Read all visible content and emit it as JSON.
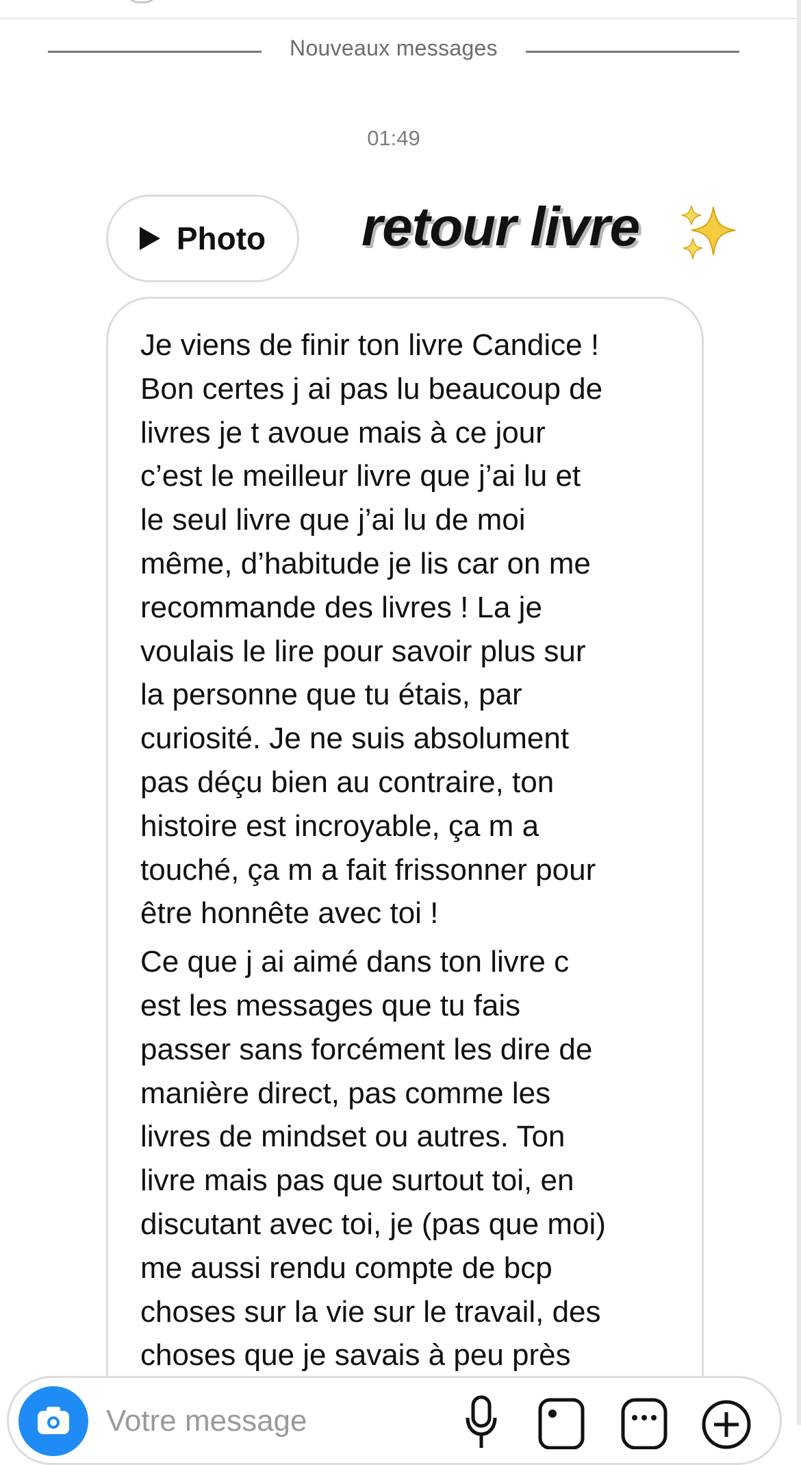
{
  "divider": {
    "label": "Nouveaux messages"
  },
  "timestamp": "01:49",
  "attachment": {
    "icon": "play-icon",
    "label": "Photo"
  },
  "sticker": {
    "text": "retour livre",
    "icon": "sparkles-icon"
  },
  "message": {
    "lines": [
      "Je viens de finir ton livre Candice !",
      "Bon certes j ai pas lu beaucoup de",
      "livres je t avoue mais à ce jour",
      "c’est le meilleur livre que j’ai lu et",
      "le seul livre que j’ai lu de moi",
      "même, d’habitude je lis car on me",
      "recommande des livres ! La je",
      "voulais le lire pour savoir plus sur",
      "la personne que tu étais, par",
      "curiosité. Je ne suis absolument",
      "pas déçu bien au contraire, ton",
      "histoire est incroyable, ça m a",
      "touché, ça m a fait frissonner pour",
      "être honnête avec toi !",
      "Ce que j ai aimé dans ton livre c",
      "est les messages que tu fais",
      "passer sans forcément les dire de",
      "manière direct, pas comme les",
      "livres de mindset ou autres. Ton",
      "livre mais pas que surtout toi, en",
      "discutant avec toi, je (pas que moi)",
      "me aussi rendu compte de bcp",
      "choses sur la vie sur le travail, des",
      "choses que je savais à peu près"
    ]
  },
  "composer": {
    "placeholder": "Votre message",
    "icons": [
      "camera-icon",
      "microphone-icon",
      "gallery-icon",
      "sticker-icon",
      "plus-icon"
    ]
  },
  "colors": {
    "accent": "#1f8cf5",
    "bubble_border": "#dcdcdc",
    "meta_text": "#7d7d7d"
  }
}
